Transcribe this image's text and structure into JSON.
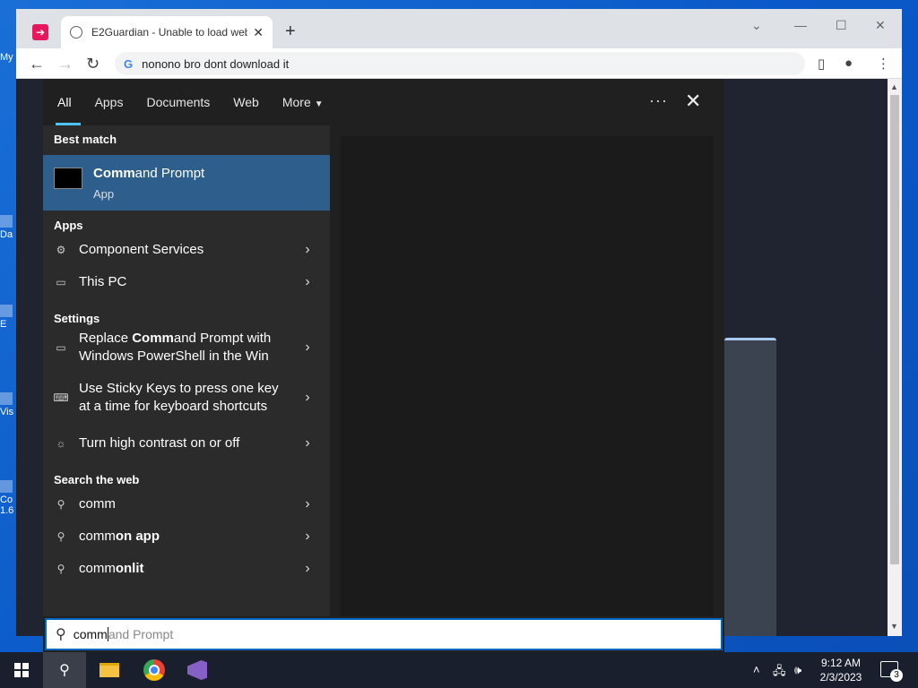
{
  "desktop": {
    "icons": [
      {
        "label": "My"
      },
      {
        "label": "Da"
      },
      {
        "label": "E"
      },
      {
        "label": "Vis"
      },
      {
        "label": "Co 1.6"
      }
    ]
  },
  "browser": {
    "tab_title": "E2Guardian - Unable to load web",
    "address": "nonono bro dont download it"
  },
  "search": {
    "tabs": {
      "all": "All",
      "apps": "Apps",
      "documents": "Documents",
      "web": "Web",
      "more": "More"
    },
    "best_match_header": "Best match",
    "best_match": {
      "name_bold": "Comm",
      "name_rest": "and Prompt",
      "type": "App"
    },
    "apps_header": "Apps",
    "apps": [
      {
        "label": "Component Services"
      },
      {
        "label": "This PC"
      }
    ],
    "settings_header": "Settings",
    "settings": [
      {
        "pre": "Replace ",
        "bold": "Comm",
        "post": "and Prompt with Windows PowerShell in the Win"
      },
      {
        "pre": "Use Sticky Keys to press one key at a time for keyboard shortcuts",
        "bold": "",
        "post": ""
      },
      {
        "pre": "Turn high contrast on or off",
        "bold": "",
        "post": ""
      }
    ],
    "web_header": "Search the web",
    "web": [
      {
        "pre": "comm",
        "bold": ""
      },
      {
        "pre": "comm",
        "bold": "on app"
      },
      {
        "pre": "comm",
        "bold": "onlit"
      }
    ],
    "query_typed": "comm",
    "query_suggest": "and Prompt"
  },
  "taskbar": {
    "time": "9:12 AM",
    "date": "2/3/2023",
    "notification_count": "3"
  }
}
